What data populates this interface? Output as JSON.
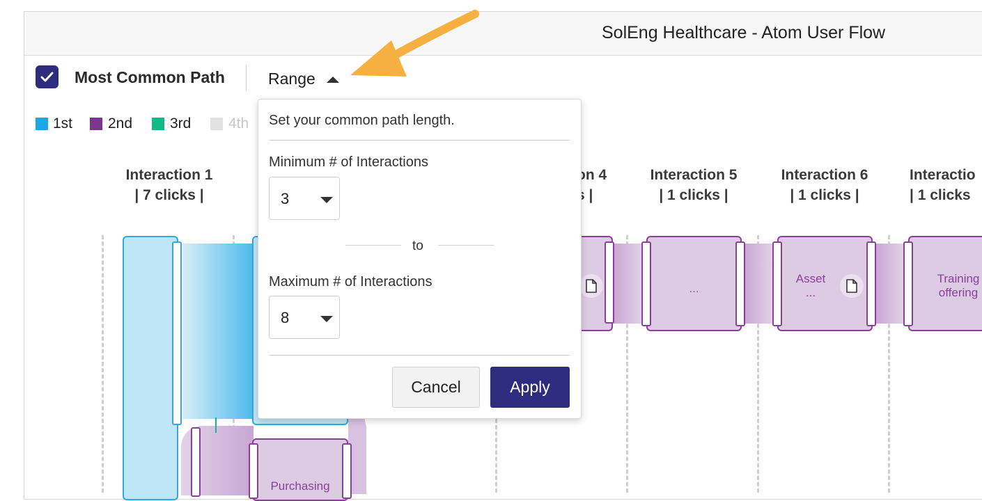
{
  "header": {
    "title": "SolEng Healthcare - Atom User Flow"
  },
  "toolbar": {
    "most_common_path_label": "Most Common Path",
    "most_common_path_checked": true,
    "range_label": "Range"
  },
  "legend": [
    {
      "label": "1st",
      "color": "#1fa7e1"
    },
    {
      "label": "2nd",
      "color": "#7b3790"
    },
    {
      "label": "3rd",
      "color": "#14b884"
    },
    {
      "label": "4th",
      "color": "#e2e2e2"
    }
  ],
  "columns": [
    {
      "title": "Interaction 1",
      "clicks": "| 7 clicks |"
    },
    {
      "title": "on 4",
      "clicks": "s |"
    },
    {
      "title": "Interaction 5",
      "clicks": "| 1 clicks |"
    },
    {
      "title": "Interaction 6",
      "clicks": "| 1 clicks |"
    },
    {
      "title": "Interactio",
      "clicks": "| 1 clicks"
    }
  ],
  "nodes": {
    "col5": {
      "label": "..."
    },
    "col6": {
      "label": "Asset",
      "sub": "..."
    },
    "col7": {
      "label": "Training",
      "sub": "offering"
    },
    "col2_lower": {
      "label": "Purchasing"
    }
  },
  "range_popover": {
    "description": "Set your common path length.",
    "min_label": "Minimum # of Interactions",
    "min_value": "3",
    "to_label": "to",
    "max_label": "Maximum # of Interactions",
    "max_value": "8",
    "cancel_label": "Cancel",
    "apply_label": "Apply"
  },
  "colors": {
    "accent": "#2d2c7e",
    "node_purple": "#dccbe3",
    "node_border": "#8a3f99",
    "node_blue": "#bfe6f7",
    "arrow": "#f5b041"
  }
}
